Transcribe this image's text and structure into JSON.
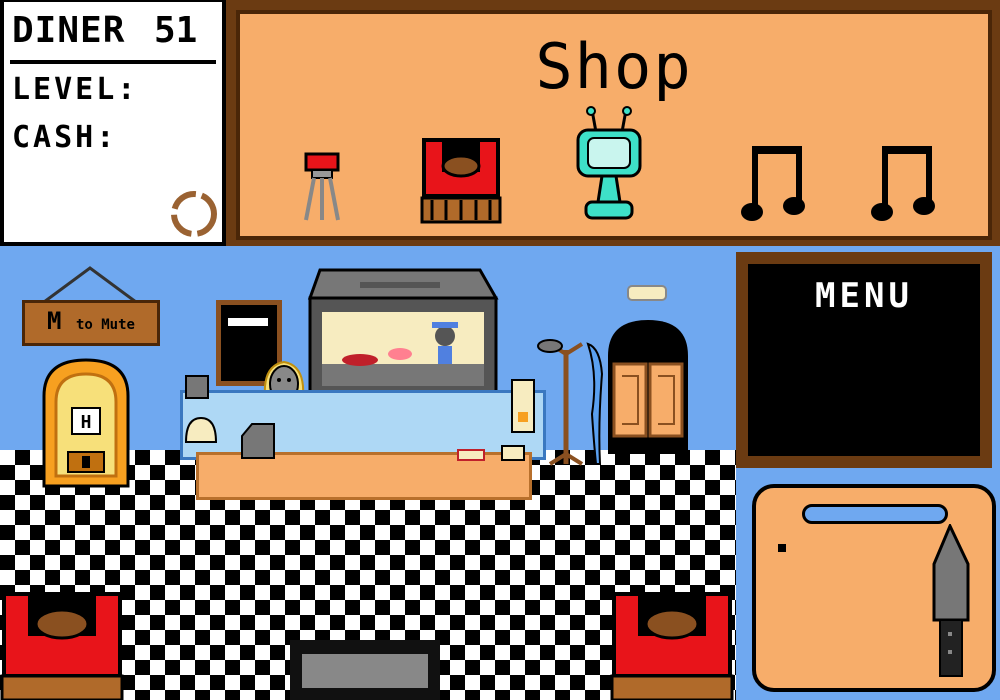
{
  "stats": {
    "title": "DINER",
    "number": "51",
    "level_label": "LEVEL:",
    "cash_label": "CASH:"
  },
  "shop": {
    "title": "Shop",
    "items": [
      {
        "name": "stool-icon"
      },
      {
        "name": "booth-icon"
      },
      {
        "name": "robot-tv-icon"
      },
      {
        "name": "music-note-icon"
      },
      {
        "name": "music-note-icon"
      }
    ]
  },
  "menu": {
    "title": "MENU"
  },
  "mute_sign": {
    "big": "M",
    "small": "to Mute"
  },
  "colors": {
    "wall": "#6fa8f0",
    "shop_panel": "#f7ad6a",
    "frame": "#6b3b12",
    "booth_red": "#e8141a",
    "robot_teal": "#3ee0c8"
  }
}
